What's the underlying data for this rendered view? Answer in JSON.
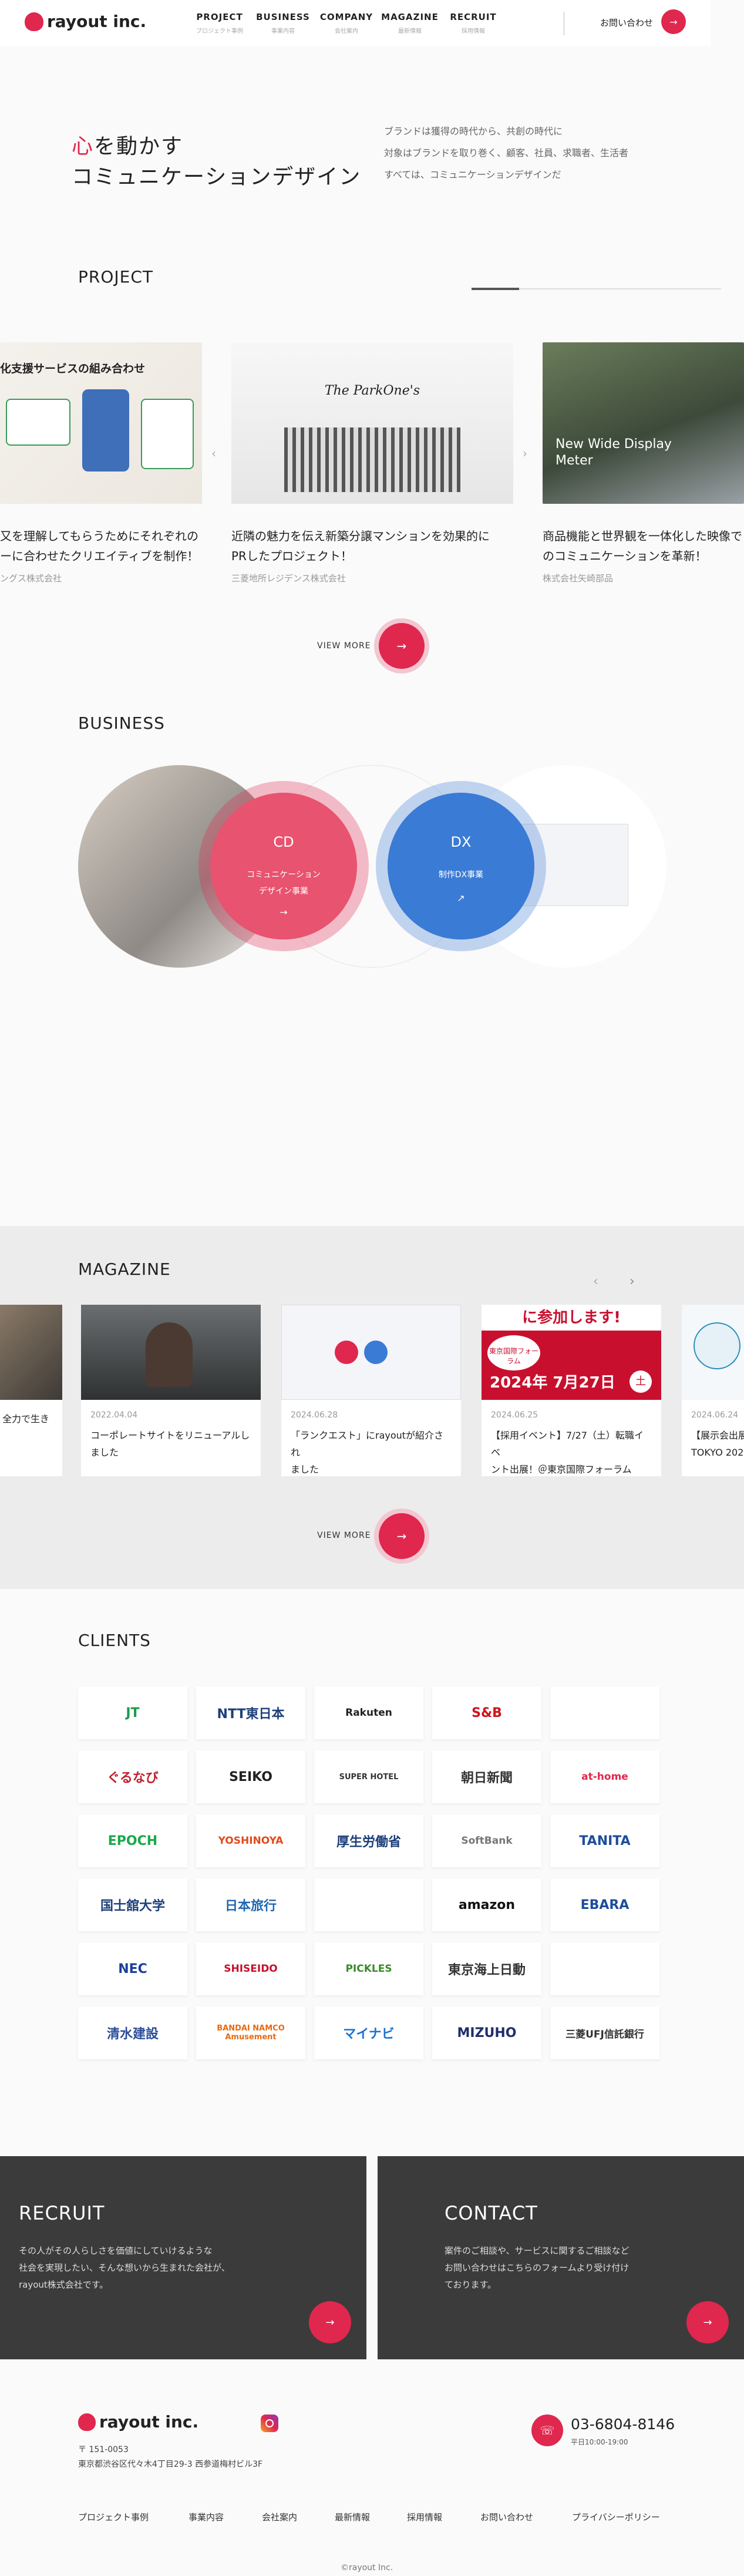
{
  "header": {
    "logo_text": "rayout inc.",
    "nav": [
      {
        "main": "PROJECT",
        "sub": "プロジェクト事例"
      },
      {
        "main": "BUSINESS",
        "sub": "事業内容"
      },
      {
        "main": "COMPANY",
        "sub": "会社案内"
      },
      {
        "main": "MAGAZINE",
        "sub": "最新情報"
      },
      {
        "main": "RECRUIT",
        "sub": "採用情報"
      }
    ],
    "contact": "お問い合わせ"
  },
  "hero": {
    "line1_red": "心",
    "line1_rest": "を動かす",
    "line2": "コミュニケーションデザイン",
    "desc": [
      "ブランドは獲得の時代から、共創の時代に",
      "対象はブランドを取り巻く、顧客、社員、求職者、生活者",
      "すべては、コミュニケーションデザインだ"
    ]
  },
  "project": {
    "title": "PROJECT",
    "progress": 0.19,
    "cards": [
      {
        "img_text": "化支援サービスの組み合わせ",
        "caption": [
          "又を理解してもらうためにそれぞれの",
          "ーに合わせたクリエイティブを制作！"
        ],
        "client": "ングス株式会社"
      },
      {
        "img_text": "The ParkOne's",
        "caption": [
          "近隣の魅力を伝え新築分譲マンションを効果的に",
          "PRしたプロジェクト！"
        ],
        "client": "三菱地所レジデンス株式会社"
      },
      {
        "img_text": "New Wide Display Meter",
        "caption": [
          "商品機能と世界観を一体化した映像で",
          "のコミュニケーションを革新！"
        ],
        "client": "株式会社矢崎部品"
      }
    ],
    "view_more": "VIEW MORE"
  },
  "business": {
    "title": "BUSINESS",
    "cd": {
      "abbr": "CD",
      "name": [
        "コミュニケーション",
        "デザイン事業"
      ]
    },
    "dx": {
      "abbr": "DX",
      "name": [
        "制作DX事業"
      ]
    }
  },
  "magazine": {
    "title": "MAGAZINE",
    "cards": [
      {
        "date": "",
        "title": [
          "全力で生き",
          ""
        ]
      },
      {
        "date": "2022.04.04",
        "title": [
          "コーポレートサイトをリニューアルし",
          "ました"
        ]
      },
      {
        "date": "2024.06.28",
        "title": [
          "「ランクエスト」にrayoutが紹介され",
          "ました"
        ]
      },
      {
        "date": "2024.06.25",
        "title": [
          "【採用イベント】7/27（土）転職イベ",
          "ント出展！＠東京国際フォーラム"
        ]
      },
      {
        "date": "2024.06.24",
        "title": [
          "【展示会出展",
          "TOKYO 2024"
        ]
      }
    ],
    "event_banner": {
      "top": "に参加します!",
      "forum": "東京国際フォーラム",
      "date": "2024年 7月27日",
      "day": "土"
    },
    "view_more": "VIEW MORE"
  },
  "clients": {
    "title": "CLIENTS",
    "logos": [
      {
        "name": "JT",
        "color": "#1a9b4b"
      },
      {
        "name": "NTT東日本",
        "color": "#1d3f7a"
      },
      {
        "name": "Rakuten",
        "color": "#222222"
      },
      {
        "name": "S&B",
        "color": "#d1121e"
      },
      {
        "name": "",
        "color": "#cccccc"
      },
      {
        "name": "ぐるなび",
        "color": "#c0202c"
      },
      {
        "name": "SEIKO",
        "color": "#222222"
      },
      {
        "name": "SUPER HOTEL",
        "color": "#333333"
      },
      {
        "name": "朝日新聞",
        "color": "#333333"
      },
      {
        "name": "at-home",
        "color": "#e0274e"
      },
      {
        "name": "EPOCH",
        "color": "#1aa84a"
      },
      {
        "name": "YOSHINOYA",
        "color": "#e24b1c"
      },
      {
        "name": "厚生労働省",
        "color": "#1d3f7a"
      },
      {
        "name": "SoftBank",
        "color": "#777777"
      },
      {
        "name": "TANITA",
        "color": "#1d4d9a"
      },
      {
        "name": "国士舘大学",
        "color": "#1d3f7a"
      },
      {
        "name": "日本旅行",
        "color": "#2066b0"
      },
      {
        "name": "",
        "color": "#2a8fb8"
      },
      {
        "name": "amazon",
        "color": "#111111"
      },
      {
        "name": "EBARA",
        "color": "#1d4d9a"
      },
      {
        "name": "NEC",
        "color": "#1d3f9a"
      },
      {
        "name": "SHISEIDO",
        "color": "#c8102e"
      },
      {
        "name": "PICKLES",
        "color": "#3a8a2a"
      },
      {
        "name": "東京海上日動",
        "color": "#333333"
      },
      {
        "name": "",
        "color": "#4aa8c8"
      },
      {
        "name": "清水建設",
        "color": "#2a4d9a"
      },
      {
        "name": "BANDAI NAMCO Amusement",
        "color": "#e86a10"
      },
      {
        "name": "マイナビ",
        "color": "#1b72d0"
      },
      {
        "name": "MIZUHO",
        "color": "#1d2f6a"
      },
      {
        "name": "三菱UFJ信託銀行",
        "color": "#333333"
      }
    ]
  },
  "recruit": {
    "title": "RECRUIT",
    "desc": [
      "その人がその人らしさを価値にしていけるような",
      "社会を実現したい、そんな想いから生まれた会社が、",
      "rayout株式会社です。"
    ]
  },
  "contact": {
    "title": "CONTACT",
    "desc": [
      "案件のご相談や、サービスに関するご相談など",
      "お問い合わせはこちらのフォームより受け付け",
      "ております。"
    ]
  },
  "footer": {
    "logo_text": "rayout inc.",
    "zip": "〒 151-0053",
    "address": "東京都渋谷区代々木4丁目29-3 西参道梅村ビル3F",
    "phone": "03-6804-8146",
    "hours": "平日10:00-19:00",
    "links": [
      "プロジェクト事例",
      "事業内容",
      "会社案内",
      "最新情報",
      "採用情報",
      "お問い合わせ",
      "プライバシーポリシー"
    ],
    "copyright": "©rayout Inc."
  },
  "colors": {
    "accent": "#e0274e",
    "dx": "#3a7bd5",
    "dark": "#3b3b3b"
  }
}
